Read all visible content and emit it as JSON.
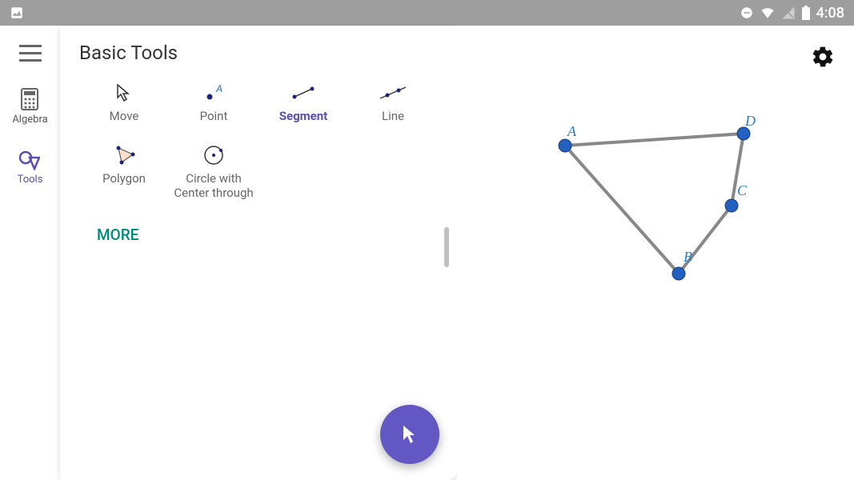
{
  "status": {
    "time": "4:08"
  },
  "sidebar": {
    "items": [
      {
        "label": ""
      },
      {
        "label": "Algebra"
      },
      {
        "label": "Tools"
      }
    ]
  },
  "panel": {
    "title": "Basic Tools",
    "tools": [
      {
        "label": "Move",
        "selected": false
      },
      {
        "label": "Point",
        "selected": false
      },
      {
        "label": "Segment",
        "selected": true
      },
      {
        "label": "Line",
        "selected": false
      },
      {
        "label": "Polygon",
        "selected": false
      },
      {
        "label": "Circle with Center through",
        "selected": false
      }
    ],
    "more": "MORE"
  },
  "graph": {
    "points": {
      "A": "A",
      "B": "B",
      "C": "C",
      "D": "D"
    }
  }
}
